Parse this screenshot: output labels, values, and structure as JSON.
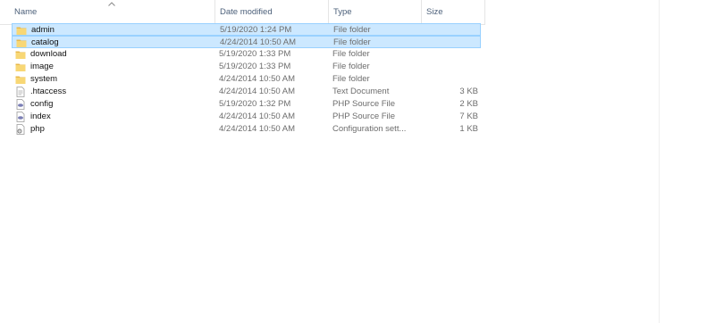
{
  "columns": {
    "name": "Name",
    "date_modified": "Date modified",
    "type": "Type",
    "size": "Size"
  },
  "sort": {
    "column": "name",
    "direction": "ascending",
    "icon": "chevron-up-icon"
  },
  "files": [
    {
      "name": "admin",
      "date": "5/19/2020 1:24 PM",
      "type": "File folder",
      "size": "",
      "icon": "folder-icon",
      "selected": true
    },
    {
      "name": "catalog",
      "date": "4/24/2014 10:50 AM",
      "type": "File folder",
      "size": "",
      "icon": "folder-icon",
      "selected": true
    },
    {
      "name": "download",
      "date": "5/19/2020 1:33 PM",
      "type": "File folder",
      "size": "",
      "icon": "folder-icon",
      "selected": false
    },
    {
      "name": "image",
      "date": "5/19/2020 1:33 PM",
      "type": "File folder",
      "size": "",
      "icon": "folder-icon",
      "selected": false
    },
    {
      "name": "system",
      "date": "4/24/2014 10:50 AM",
      "type": "File folder",
      "size": "",
      "icon": "folder-icon",
      "selected": false
    },
    {
      "name": ".htaccess",
      "date": "4/24/2014 10:50 AM",
      "type": "Text Document",
      "size": "3 KB",
      "icon": "text-document-icon",
      "selected": false
    },
    {
      "name": "config",
      "date": "5/19/2020 1:32 PM",
      "type": "PHP Source File",
      "size": "2 KB",
      "icon": "php-file-icon",
      "selected": false
    },
    {
      "name": "index",
      "date": "4/24/2014 10:50 AM",
      "type": "PHP Source File",
      "size": "7 KB",
      "icon": "php-file-icon",
      "selected": false
    },
    {
      "name": "php",
      "date": "4/24/2014 10:50 AM",
      "type": "Configuration sett...",
      "size": "1 KB",
      "icon": "config-file-icon",
      "selected": false
    }
  ],
  "colors": {
    "selection_bg": "#cce8ff",
    "selection_border": "#99d1ff",
    "folder": "#f8d775",
    "header_text": "#4c607a",
    "secondary_text": "#6d6d6d"
  }
}
